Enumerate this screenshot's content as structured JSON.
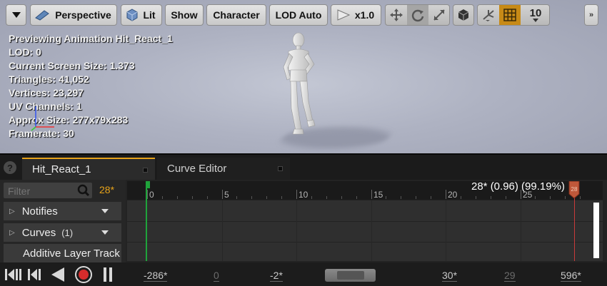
{
  "toolbar": {
    "perspective_label": "Perspective",
    "lit_label": "Lit",
    "show_label": "Show",
    "character_label": "Character",
    "lod_label": "LOD Auto",
    "speed_label": "x1.0",
    "snap_value": "10"
  },
  "viewport_info": {
    "line1": "Previewing Animation Hit_React_1",
    "line2": "LOD: 0",
    "line3": "Current Screen Size: 1.373",
    "line4": "Triangles: 41,052",
    "line5": "Vertices: 23,297",
    "line6": "UV Channels: 1",
    "line7": "Approx Size: 277x79x283",
    "line8": "Framerate: 30"
  },
  "tabs": {
    "active": "Hit_React_1",
    "inactive": "Curve Editor"
  },
  "left_panel": {
    "filter_placeholder": "Filter",
    "frame_count": "28*",
    "tracks": [
      {
        "label": "Notifies",
        "count": ""
      },
      {
        "label": "Curves",
        "count": "(1)"
      },
      {
        "label": "Additive Layer Track",
        "count": ""
      }
    ]
  },
  "timeline": {
    "ticks": [
      "0",
      "5",
      "10",
      "15",
      "20",
      "25"
    ],
    "current_time": "28* (0.96) (99.19%)",
    "end_marker": "28"
  },
  "transport": {
    "view_start": "-286*",
    "play_start": "0",
    "selection_start": "-2*",
    "selection_end": "30*",
    "play_end": "29",
    "view_end": "596*"
  },
  "colors": {
    "accent": "#e6a21a",
    "playhead": "#1fa33b",
    "end_marker": "#c93a3a",
    "record": "#d62c2c"
  }
}
